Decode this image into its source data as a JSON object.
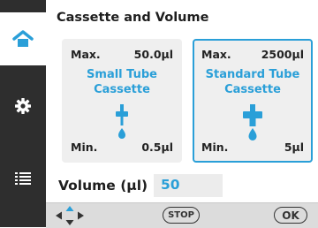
{
  "header": {
    "title": "Cassette and Volume"
  },
  "sidebar": {
    "items": [
      {
        "icon": "home-icon",
        "active": true
      },
      {
        "icon": "gear-icon",
        "active": false
      },
      {
        "icon": "list-icon",
        "active": false
      }
    ]
  },
  "cassettes": [
    {
      "max_label": "Max.",
      "max_value": "50.0µl",
      "name_line1": "Small Tube",
      "name_line2": "Cassette",
      "min_label": "Min.",
      "min_value": "0.5µl",
      "selected": false
    },
    {
      "max_label": "Max.",
      "max_value": "2500µl",
      "name_line1": "Standard Tube",
      "name_line2": "Cassette",
      "min_label": "Min.",
      "min_value": "5µl",
      "selected": true
    }
  ],
  "volume": {
    "label": "Volume (µl)",
    "value": "50"
  },
  "footer": {
    "stop_label": "STOP",
    "ok_label": "OK"
  },
  "colors": {
    "accent": "#2a9fd8",
    "sidebar": "#2e2e2e",
    "footer": "#dcdcdc"
  }
}
